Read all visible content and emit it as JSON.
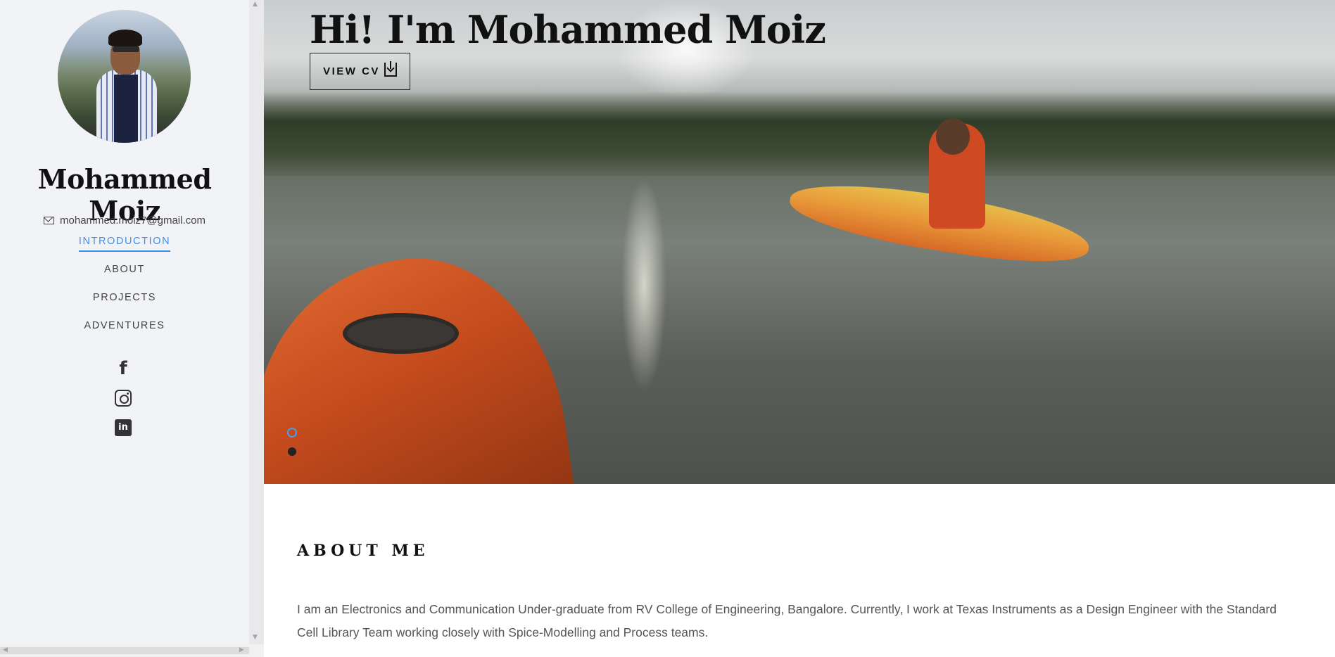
{
  "sidebar": {
    "name": "Mohammed Moiz",
    "email": "mohammed.moiz7@gmail.com",
    "nav": [
      {
        "label": "INTRODUCTION",
        "active": true
      },
      {
        "label": "ABOUT",
        "active": false
      },
      {
        "label": "PROJECTS",
        "active": false
      },
      {
        "label": "ADVENTURES",
        "active": false
      }
    ],
    "social": [
      "facebook-icon",
      "instagram-icon",
      "linkedin-icon"
    ],
    "accent_color": "#3e8ee5"
  },
  "hero": {
    "title": "Hi! I'm Mohammed Moiz",
    "cv_button": "VIEW CV",
    "slides_total": 2,
    "slide_active": 1
  },
  "about": {
    "heading": "ABOUT ME",
    "text": "I am an Electronics and Communication Under-graduate from RV College of Engineering, Bangalore. Currently, I work at Texas Instruments as a Design Engineer with the Standard Cell Library Team working closely with Spice-Modelling and Process teams."
  }
}
